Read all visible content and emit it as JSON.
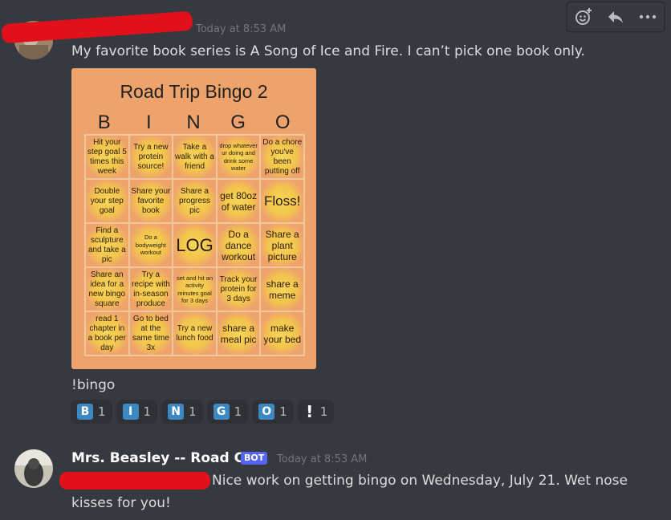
{
  "toolbar": {
    "add_reaction_icon": "add-reaction-icon",
    "reply_icon": "reply-icon",
    "more_icon": "more-icon"
  },
  "message1": {
    "timestamp": "Today at 8:53 AM",
    "text": "My favorite book series is A Song of Ice and Fire. I can’t pick one book only.",
    "bingo": {
      "title": "Road Trip Bingo 2",
      "letters": [
        "B",
        "I",
        "N",
        "G",
        "O"
      ],
      "cells": [
        [
          "Hit your step goal 5 times this week",
          "Try a new protein source!",
          "Take a walk with a friend",
          "drop whatever ur doing and drink some water",
          "Do a chore you've been putting off"
        ],
        [
          "Double your step goal",
          "Share your favorite book",
          "Share a progress pic",
          "get 80oz of water",
          "Floss!"
        ],
        [
          "Find a sculpture and take a pic",
          "Do a bodyweight workout",
          "LOG",
          "Do a dance workout",
          "Share a plant picture"
        ],
        [
          "Share an idea for a new bingo square",
          "Try a recipe with in-season produce",
          "set and hit an activity minutes goal for 3 days",
          "Track your protein for 3 days",
          "share a meme"
        ],
        [
          "read 1 chapter in a book per day",
          "Go to bed at the same time 3x",
          "Try a new lunch food",
          "share a meal pic",
          "make your bed"
        ]
      ]
    },
    "command": "!bingo",
    "reactions": [
      {
        "emoji": "B",
        "count": "1"
      },
      {
        "emoji": "I",
        "count": "1"
      },
      {
        "emoji": "N",
        "count": "1"
      },
      {
        "emoji": "G",
        "count": "1"
      },
      {
        "emoji": "O",
        "count": "1"
      },
      {
        "emoji": "!",
        "count": "1"
      }
    ]
  },
  "message2": {
    "username": "Mrs. Beasley -- Road Cat",
    "bot_tag": "BOT",
    "timestamp": "Today at 8:53 AM",
    "text_line1": "Nice work on getting bingo on Wednesday, July 21. Wet nose",
    "text_line2": "kisses for you!"
  },
  "colors": {
    "background": "#36393f",
    "card": "#eea36d",
    "redaction": "#e0111a",
    "reaction_emoji": "#3b88c3",
    "bot_tag": "#5865f2"
  }
}
